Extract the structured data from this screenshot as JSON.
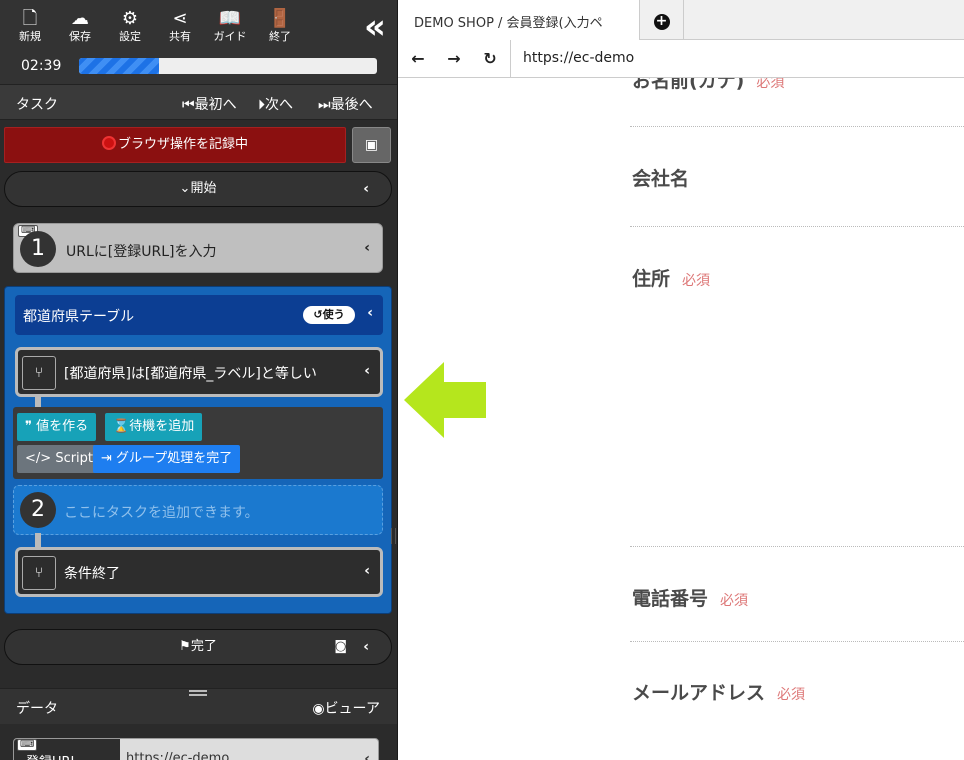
{
  "toolbar": {
    "buttons": [
      {
        "label": "新規",
        "icon": "file-icon",
        "glyph": "🗋"
      },
      {
        "label": "保存",
        "icon": "cloud-upload-icon",
        "glyph": "☁"
      },
      {
        "label": "設定",
        "icon": "gear-icon",
        "glyph": "⚙"
      },
      {
        "label": "共有",
        "icon": "share-icon",
        "glyph": "⋖"
      },
      {
        "label": "ガイド",
        "icon": "book-icon",
        "glyph": "📖"
      },
      {
        "label": "終了",
        "icon": "exit-door-icon",
        "glyph": "🚪"
      }
    ],
    "collapse_glyph": "«",
    "timer": "02:39",
    "progress_percent": 27
  },
  "tasks": {
    "title": "タスク",
    "nav_first": "最初へ",
    "nav_next": "次へ",
    "nav_last": "最後へ"
  },
  "record": {
    "label": "ブラウザ操作を記録中"
  },
  "start": {
    "label": "開始"
  },
  "step1": {
    "number": "1",
    "text": "URLに[登録URL]を入力"
  },
  "group": {
    "title": "都道府県テーブル",
    "use_label": "使う",
    "condition": "[都道府県]は[都道府県_ラベル]と等しい",
    "actions": {
      "make_value": "値を作る",
      "add_wait": "待機を追加",
      "script": "Script",
      "finish_group": "グループ処理を完了"
    },
    "add_placeholder_number": "2",
    "add_placeholder": "ここにタスクを追加できます。",
    "end_condition": "条件終了"
  },
  "finish": {
    "label": "完了"
  },
  "data": {
    "title": "データ",
    "viewer": "ビューア",
    "row_key": "登録URL",
    "row_value": "https://ec-demo"
  },
  "browser": {
    "tab_title": "DEMO SHOP / 会員登録(入力ペ",
    "url": "https://ec-demo",
    "fields": [
      {
        "label": "お名前(カナ)",
        "required": "必須"
      },
      {
        "label": "会社名",
        "required": ""
      },
      {
        "label": "住所",
        "required": "必須"
      },
      {
        "label": "電話番号",
        "required": "必須"
      },
      {
        "label": "メールアドレス",
        "required": "必須"
      }
    ]
  },
  "colors": {
    "accent_blue": "#1565b8",
    "record_red": "#8b1010",
    "arrow_green": "#b5e61d"
  }
}
